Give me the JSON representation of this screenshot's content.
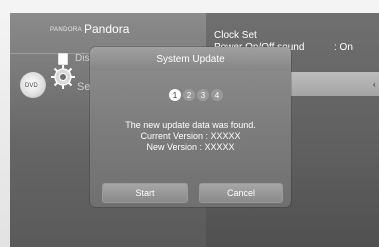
{
  "left_menu": {
    "brand_small": "PANDORA",
    "brand_big": "Pandora",
    "disc_label": "Disc",
    "settings_label": "Set",
    "dvd_label": "DVD"
  },
  "right_menu": {
    "clock_set": "Clock Set",
    "power_onoff": "Power On/Off sound",
    "power_onoff_value": ": On",
    "arrow": "‹"
  },
  "popup": {
    "title": "System Update",
    "steps": [
      "1",
      "2",
      "3",
      "4"
    ],
    "active_step": 1,
    "message_lines": [
      "The new update data was found.",
      "Current Version : XXXXX",
      "New Version : XXXXX"
    ],
    "start_label": "Start",
    "cancel_label": "Cancel"
  }
}
